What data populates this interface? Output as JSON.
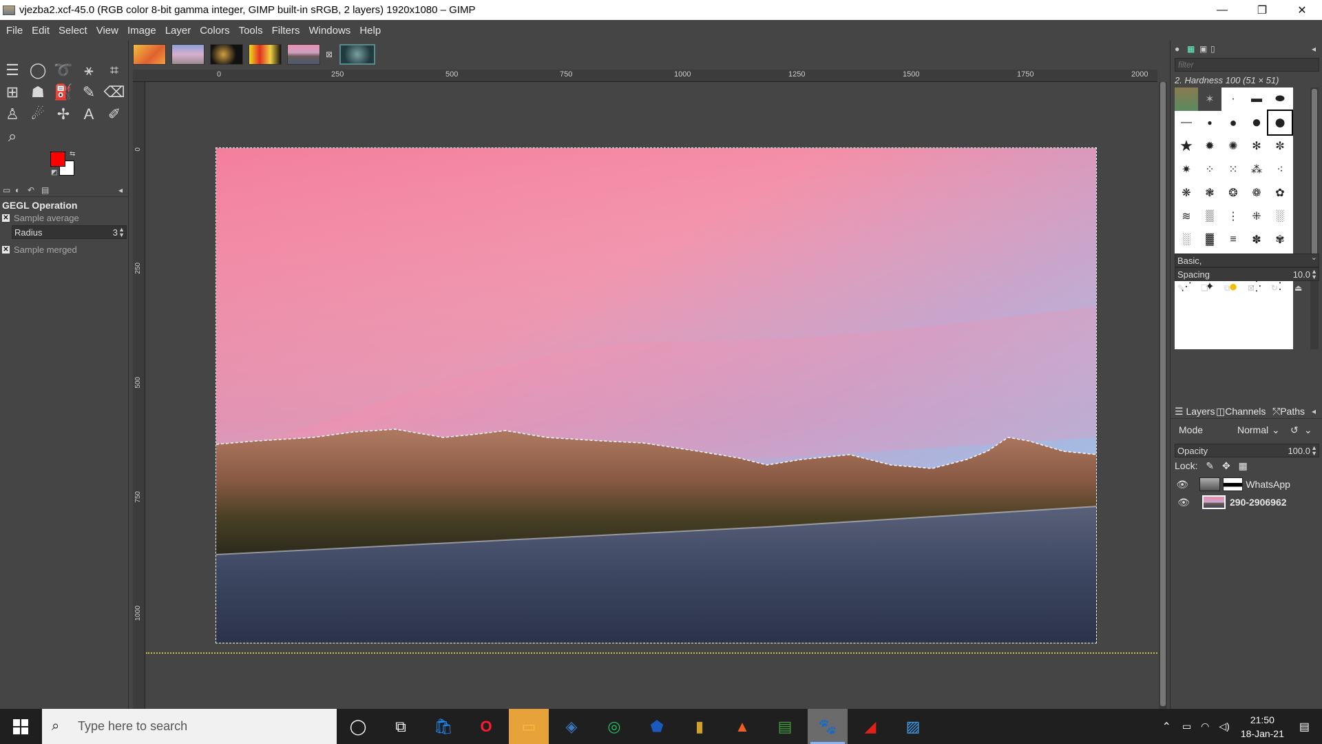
{
  "window": {
    "title": "vjezba2.xcf-45.0 (RGB color 8-bit gamma integer, GIMP built-in sRGB, 2 layers) 1920x1080 – GIMP",
    "minimize": "—",
    "maximize": "❐",
    "close": "✕"
  },
  "menu": [
    "File",
    "Edit",
    "Select",
    "View",
    "Image",
    "Layer",
    "Colors",
    "Tools",
    "Filters",
    "Windows",
    "Help"
  ],
  "toolbox": {
    "fg_color": "#ff0000",
    "bg_color": "#ffffff"
  },
  "tool_options": {
    "title": "GEGL Operation",
    "sample_average": "Sample average",
    "radius_label": "Radius",
    "radius_value": "3",
    "sample_merged": "Sample merged"
  },
  "rulers": {
    "h_labels": [
      "0",
      "250",
      "500",
      "750",
      "1000",
      "1250",
      "1500",
      "1750",
      "2000"
    ],
    "v_labels": [
      "0",
      "250",
      "500",
      "750",
      "1000"
    ]
  },
  "brushes": {
    "filter_placeholder": "filter",
    "selected": "2. Hardness 100 (51 × 51)",
    "preset": "Basic,",
    "spacing_label": "Spacing",
    "spacing_value": "10.0"
  },
  "layers_panel": {
    "tabs": [
      "Layers",
      "Channels",
      "Paths"
    ],
    "mode_label": "Mode",
    "mode_value": "Normal",
    "opacity_label": "Opacity",
    "opacity_value": "100.0",
    "lock_label": "Lock:",
    "layers": [
      {
        "name": "WhatsApp",
        "visible": true
      },
      {
        "name": "290-2906962",
        "visible": true
      }
    ]
  },
  "taskbar": {
    "search_placeholder": "Type here to search",
    "time": "21:50",
    "date": "18-Jan-21"
  }
}
